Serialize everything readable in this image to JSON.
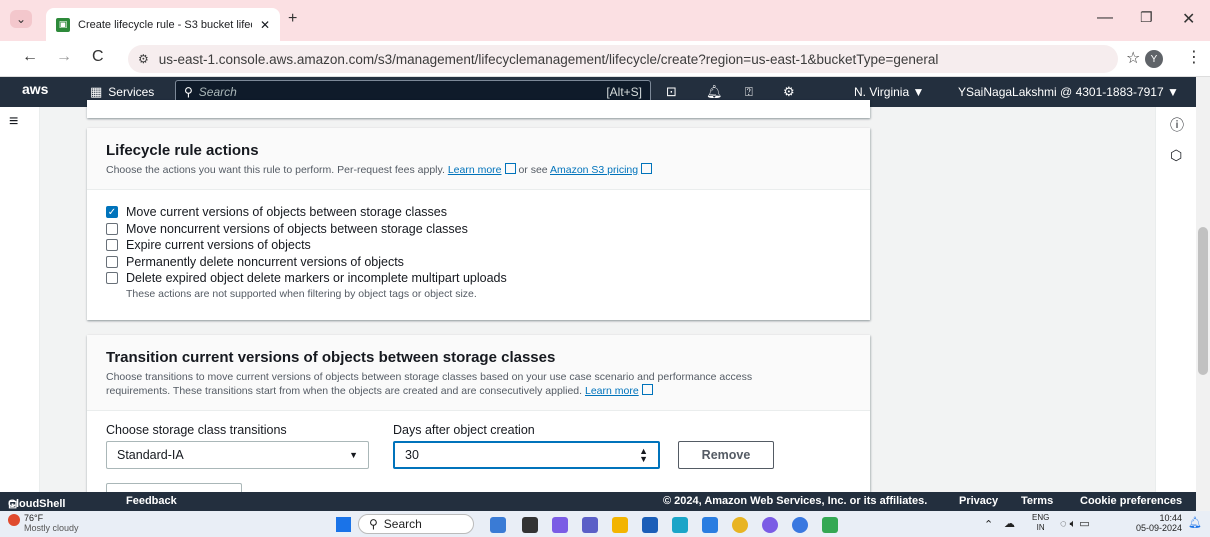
{
  "browser": {
    "tab_title": "Create lifecycle rule - S3 bucket lifecycl",
    "new_tab": "+",
    "url": "us-east-1.console.aws.amazon.com/s3/management/lifecyclemanagement/lifecycle/create?region=us-east-1&bucketType=general",
    "profile_initial": "Y"
  },
  "aws_nav": {
    "logo": "aws",
    "services": "Services",
    "search_placeholder": "Search",
    "shortcut": "[Alt+S]",
    "region": "N. Virginia ▼",
    "account": "YSaiNagaLakshmi @ 4301-1883-7917 ▼"
  },
  "actions_panel": {
    "title": "Lifecycle rule actions",
    "desc_prefix": "Choose the actions you want this rule to perform. Per-request fees apply.",
    "learn_more": "Learn more",
    "or_see": "or see",
    "pricing_link": "Amazon S3 pricing",
    "options": [
      {
        "label": "Move current versions of objects between storage classes",
        "checked": true
      },
      {
        "label": "Move noncurrent versions of objects between storage classes",
        "checked": false
      },
      {
        "label": "Expire current versions of objects",
        "checked": false
      },
      {
        "label": "Permanently delete noncurrent versions of objects",
        "checked": false
      },
      {
        "label": "Delete expired object delete markers or incomplete multipart uploads",
        "checked": false
      }
    ],
    "note": "These actions are not supported when filtering by object tags or object size."
  },
  "transition_panel": {
    "title": "Transition current versions of objects between storage classes",
    "desc_line1": "Choose transitions to move current versions of objects between storage classes based on your use case scenario and performance access",
    "desc_line2": "requirements. These transitions start from when the objects are created and are consecutively applied.",
    "learn_more": "Learn more",
    "class_label": "Choose storage class transitions",
    "class_value": "Standard-IA",
    "days_label": "Days after object creation",
    "days_value": "30",
    "remove": "Remove"
  },
  "footer": {
    "cloudshell": "CloudShell",
    "feedback": "Feedback",
    "copyright": "© 2024, Amazon Web Services, Inc. or its affiliates.",
    "privacy": "Privacy",
    "terms": "Terms",
    "cookies": "Cookie preferences"
  },
  "taskbar": {
    "temp": "76°F",
    "weather": "Mostly cloudy",
    "search": "Search",
    "lang1": "ENG",
    "lang2": "IN",
    "time": "10:44",
    "date": "05-09-2024"
  }
}
